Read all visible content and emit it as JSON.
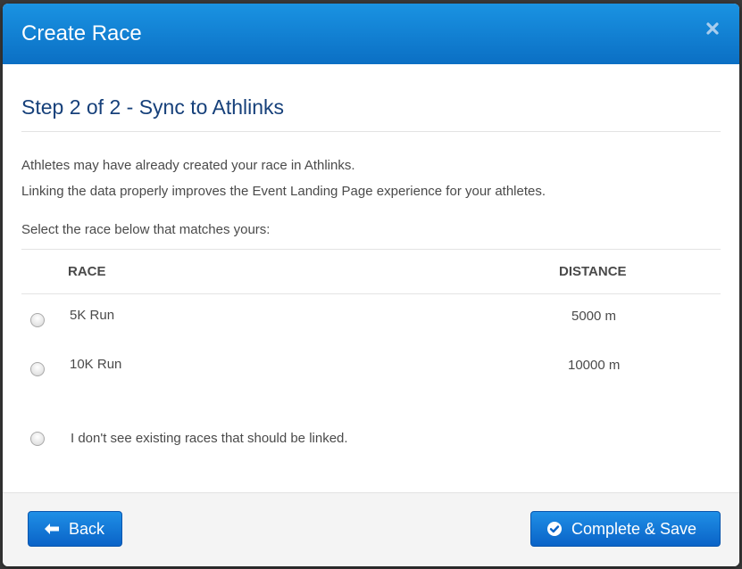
{
  "modal": {
    "title": "Create Race",
    "close_icon": "close-icon"
  },
  "step": {
    "title": "Step 2 of 2 - Sync to Athlinks"
  },
  "intro": {
    "line1": "Athletes may have already created your race in Athlinks.",
    "line2": "Linking the data properly improves the Event Landing Page experience for your athletes.",
    "line3": "Select the race below that matches yours:"
  },
  "table": {
    "headers": {
      "race": "RACE",
      "distance": "DISTANCE"
    },
    "rows": [
      {
        "race": "5K Run",
        "distance": "5000 m"
      },
      {
        "race": "10K Run",
        "distance": "10000 m"
      }
    ],
    "none_option": "I don't see existing races that should be linked."
  },
  "footer": {
    "back_label": "Back",
    "back_icon": "arrow-left-icon",
    "complete_label": "Complete & Save",
    "complete_icon": "check-circle-icon"
  },
  "colors": {
    "header_blue": "#0b6fc4",
    "title_navy": "#16407a",
    "button_blue": "#0a63c7"
  }
}
